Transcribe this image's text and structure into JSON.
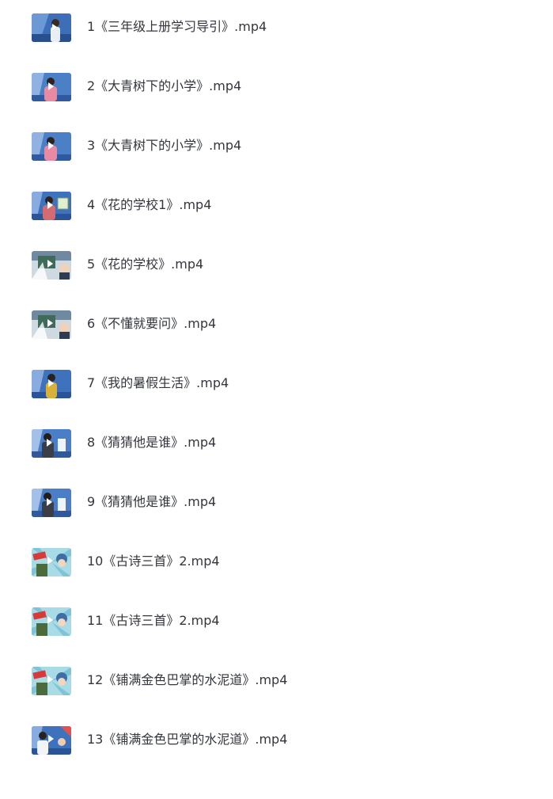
{
  "files": [
    {
      "name": "1《三年级上册学习导引》.mp4",
      "thumb": "studio-blue"
    },
    {
      "name": "2《大青树下的小学》.mp4",
      "thumb": "studio-pink"
    },
    {
      "name": "3《大青树下的小学》.mp4",
      "thumb": "studio-pink"
    },
    {
      "name": "4《花的学校1》.mp4",
      "thumb": "studio-board"
    },
    {
      "name": "5《花的学校》.mp4",
      "thumb": "cartoon-grey"
    },
    {
      "name": "6《不懂就要问》.mp4",
      "thumb": "cartoon-grey"
    },
    {
      "name": "7《我的暑假生活》.mp4",
      "thumb": "studio-yellow"
    },
    {
      "name": "8《猜猜他是谁》.mp4",
      "thumb": "studio-suit"
    },
    {
      "name": "9《猜猜他是谁》.mp4",
      "thumb": "studio-suit"
    },
    {
      "name": "10《古诗三首》2.mp4",
      "thumb": "cartoon-burst"
    },
    {
      "name": "11《古诗三首》2.mp4",
      "thumb": "cartoon-burst"
    },
    {
      "name": "12《铺满金色巴掌的水泥道》.mp4",
      "thumb": "cartoon-burst"
    },
    {
      "name": "13《铺满金色巴掌的水泥道》.mp4",
      "thumb": "studio-blue-girl"
    }
  ]
}
